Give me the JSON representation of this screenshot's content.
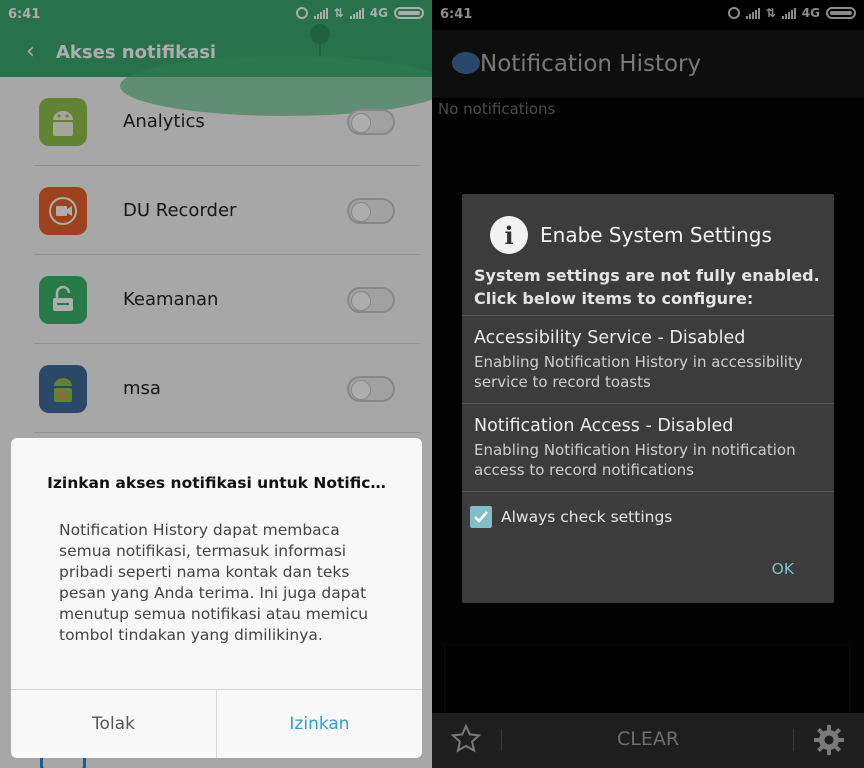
{
  "left": {
    "status": {
      "time": "6:41",
      "network": "4G"
    },
    "appbar": {
      "title": "Akses notifikasi"
    },
    "apps": [
      {
        "name": "Analytics",
        "icon": "android-icon",
        "color": "#8fc24a",
        "enabled": false
      },
      {
        "name": "DU Recorder",
        "icon": "du-recorder-icon",
        "color": "#e8622b",
        "enabled": false
      },
      {
        "name": "Keamanan",
        "icon": "unlock-icon",
        "color": "#3bb36a",
        "enabled": false
      },
      {
        "name": "msa",
        "icon": "msa-icon",
        "color": "#3f6a9a",
        "enabled": false
      }
    ],
    "dialog": {
      "title": "Izinkan akses notifikasi untuk Notific…",
      "body": "Notification History dapat membaca semua notifikasi, termasuk informasi pribadi seperti nama kontak dan teks pesan yang Anda terima. Ini juga dapat menutup semua notifikasi atau memicu tombol tindakan yang dimilikinya.",
      "deny_label": "Tolak",
      "allow_label": "Izinkan"
    },
    "accent": "#3aa96d"
  },
  "right": {
    "status": {
      "time": "6:41",
      "network": "4G"
    },
    "header": {
      "title": "Notification History"
    },
    "empty_text": "No notifications",
    "dialog": {
      "title": "Enabe System Settings",
      "message": "System settings are not fully enabled. Click below items to configure:",
      "items": [
        {
          "title": "Accessibility Service - Disabled",
          "desc": "Enabling Notification History in accessibility service to record toasts"
        },
        {
          "title": "Notification Access - Disabled",
          "desc": "Enabling Notification History in notification access to record notifications"
        }
      ],
      "checkbox_label": "Always check settings",
      "checkbox_checked": true,
      "ok_label": "OK"
    },
    "bottombar": {
      "clear_label": "CLEAR"
    },
    "accent": "#7fbfc9"
  }
}
